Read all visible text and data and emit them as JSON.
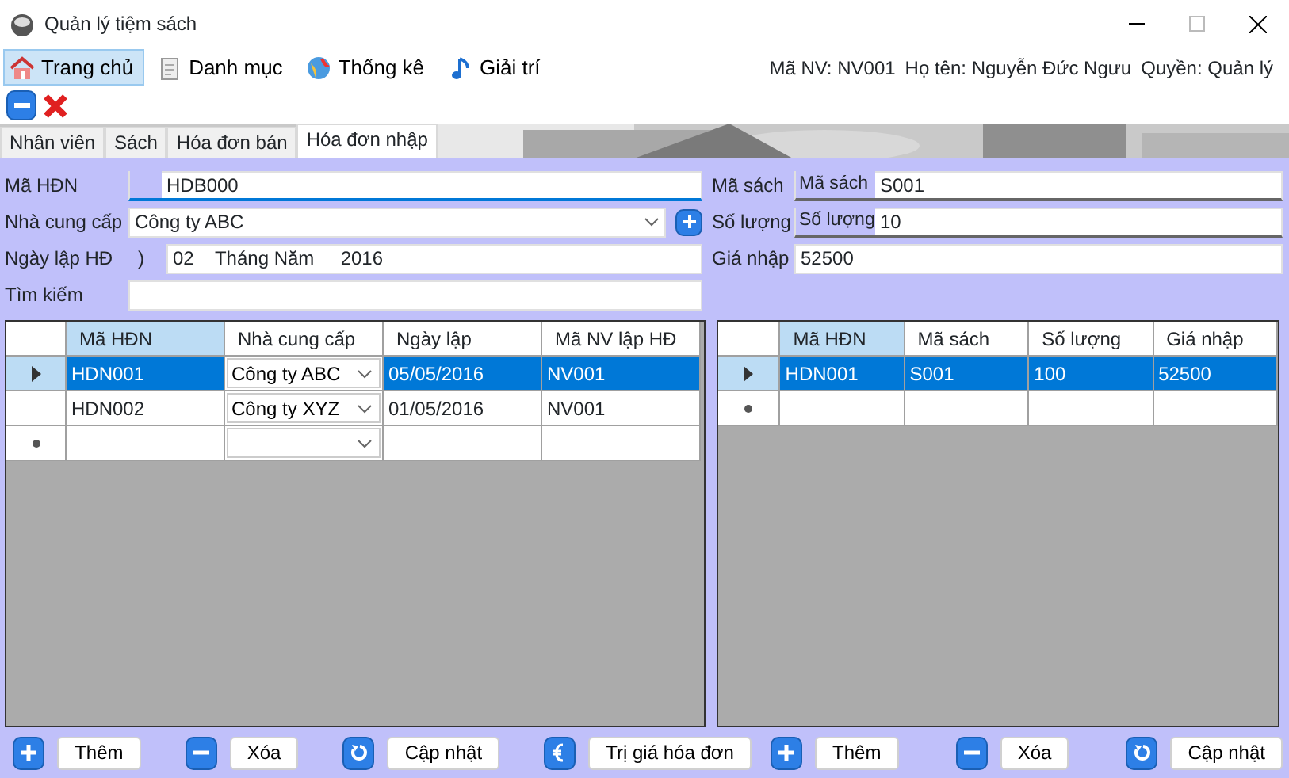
{
  "window": {
    "title": "Quản lý tiệm sách"
  },
  "menu": [
    {
      "label": "Trang chủ",
      "kind": "home",
      "selected": true
    },
    {
      "label": "Danh mục",
      "kind": "catalog",
      "selected": false
    },
    {
      "label": "Thống kê",
      "kind": "stats",
      "selected": false
    },
    {
      "label": "Giải trí",
      "kind": "fun",
      "selected": false
    }
  ],
  "user_info": [
    "Mã NV: NV001",
    "Họ tên: Nguyễn Đức Ngưu",
    "Quyền: Quản lý"
  ],
  "tabs": [
    {
      "label": "Nhân viên",
      "selected": false
    },
    {
      "label": "Sách",
      "selected": false
    },
    {
      "label": "Hóa đơn bán",
      "selected": false
    },
    {
      "label": "Hóa đơn nhập",
      "selected": true
    }
  ],
  "invoice_form": [
    {
      "kind": "text",
      "label": "Mã HĐN",
      "value": "HDB000"
    },
    {
      "kind": "combo",
      "label": "Nhà cung cấp",
      "value": "Công ty ABC"
    },
    {
      "kind": "date",
      "label": "Ngày lập HĐ",
      "prefix": ")",
      "value": "02    Tháng Năm     2016"
    },
    {
      "kind": "text",
      "label": "Tìm kiếm"
    }
  ],
  "detail_form": [
    {
      "label": "Mã sách",
      "inner_label": "Mã sách",
      "value": "S001"
    },
    {
      "label": "Số lượng",
      "inner_label": "Số lượng",
      "value": "10"
    },
    {
      "label": "Giá nhập",
      "value": "52500"
    }
  ],
  "invoice_grid": {
    "columns": [
      "Mã HĐN",
      "Nhà cung cấp",
      "Ngày lập",
      "Mã NV lập HĐ"
    ],
    "rows": [
      {
        "kind": "data",
        "selected": true,
        "cells": [
          "HDN001",
          "Công ty ABC",
          "05/05/2016",
          "NV001"
        ]
      },
      {
        "kind": "data",
        "selected": false,
        "cells": [
          "HDN002",
          "Công ty XYZ",
          "01/05/2016",
          "NV001"
        ]
      },
      {
        "kind": "new",
        "selected": false,
        "cells": [
          "",
          "",
          "",
          ""
        ]
      }
    ]
  },
  "detail_grid": {
    "columns": [
      "Mã HĐN",
      "Mã sách",
      "Số lượng",
      "Giá nhập"
    ],
    "rows": [
      {
        "kind": "data",
        "selected": true,
        "cells": [
          "HDN001",
          "S001",
          "100",
          "52500"
        ]
      },
      {
        "kind": "new",
        "selected": false,
        "cells": [
          "",
          "",
          "",
          ""
        ]
      }
    ]
  },
  "left_buttons": [
    {
      "kind": "add",
      "label": "Thêm"
    },
    {
      "kind": "delete",
      "label": "Xóa"
    },
    {
      "kind": "update",
      "label": "Cập nhật"
    },
    {
      "kind": "total",
      "label": "Trị giá hóa đơn"
    }
  ],
  "right_buttons": [
    {
      "kind": "add",
      "label": "Thêm"
    },
    {
      "kind": "delete",
      "label": "Xóa"
    },
    {
      "kind": "update",
      "label": "Cập nhật"
    }
  ]
}
